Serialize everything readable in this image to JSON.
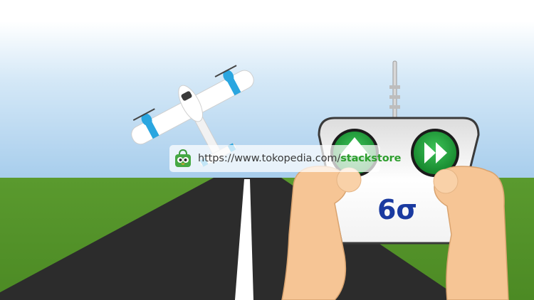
{
  "watermark": {
    "url_prefix": "https://www.tokopedia.com/",
    "url_store": "stackstore",
    "logo_icon": "tokopedia-bag-icon"
  },
  "remote": {
    "brand_label": "6σ",
    "left_button_icon": "up-arrow-icon",
    "right_button_icon": "fast-forward-icon"
  },
  "colors": {
    "sky_top": "#ffffff",
    "sky_bottom": "#a9cfee",
    "grass": "#5b9e2f",
    "runway": "#2a2a2a",
    "button_green": "#1e9a3a",
    "brand_blue": "#1a3aa0",
    "skin": "#f7c79a",
    "plane_accent": "#2aa6e0"
  }
}
